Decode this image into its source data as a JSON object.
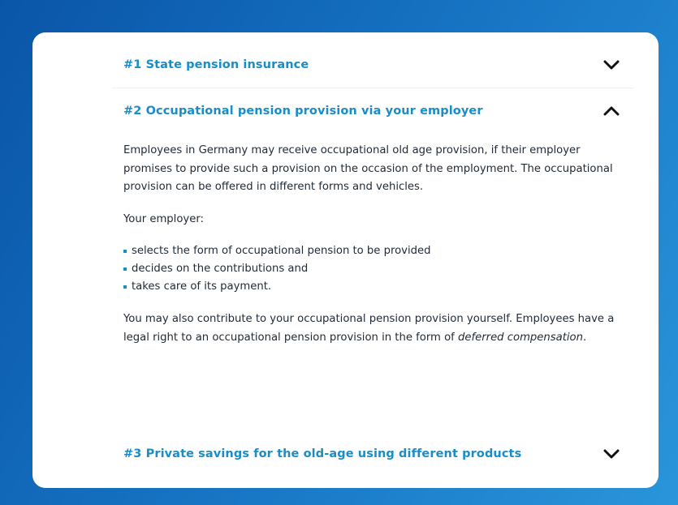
{
  "accordion": {
    "item1": {
      "title": "#1 State pension insurance",
      "chevron": "chevron-down-icon"
    },
    "item2": {
      "title": "#2 Occupational pension provision via your employer",
      "chevron": "chevron-up-icon",
      "para1": "Employees in Germany may receive occupational old age provision, if their employer promises to provide such a provision on the occasion of the employment. The occupational provision can be offered in different forms and vehicles.",
      "para2": "Your employer:",
      "bullets": [
        "selects the form of occupational pension to be provided",
        "decides on the contributions and",
        "takes care of its payment."
      ],
      "para3_start": "You may also contribute to your occupational pension provision yourself. Employees have a legal right to an occupational pension provision in the form of ",
      "para3_italic": "deferred compensation",
      "para3_end": "."
    },
    "item3": {
      "title": "#3 Private savings for the old-age using different products",
      "chevron": "chevron-down-icon"
    }
  },
  "colors": {
    "accent": "#1a8cc7",
    "text": "#1f2a36",
    "background_start": "#0a55a8",
    "background_end": "#2a95da"
  }
}
